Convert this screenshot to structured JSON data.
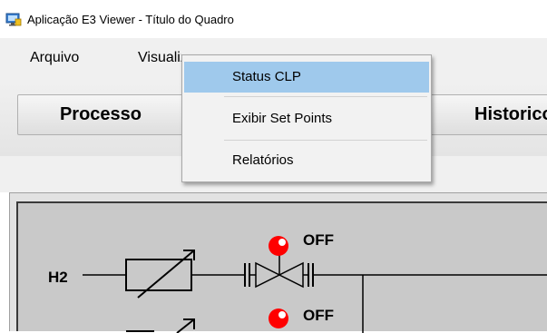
{
  "window": {
    "title": "Aplicação E3 Viewer - Título do Quadro",
    "icon": "app-icon"
  },
  "menubar": {
    "items": [
      {
        "label": "Arquivo"
      },
      {
        "label": "Visualizar"
      }
    ]
  },
  "dropdown": {
    "items": [
      {
        "label": "Status CLP",
        "highlighted": true
      },
      {
        "label": "Exibir Set Points",
        "highlighted": false
      },
      {
        "label": "Relatórios",
        "highlighted": false
      }
    ]
  },
  "toolbar": {
    "buttons": [
      {
        "label": "Processo"
      },
      {
        "label": "Historico"
      }
    ]
  },
  "diagram": {
    "line_label": "H2",
    "valve_status": [
      "OFF",
      "OFF"
    ],
    "indicator_color": "#ff0000"
  },
  "colors": {
    "menu_highlight": "#9fc9ec",
    "panel_background": "#c9c9c9"
  }
}
